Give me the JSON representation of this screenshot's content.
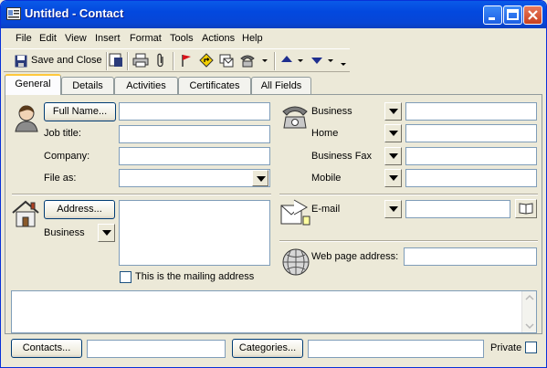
{
  "window": {
    "title": "Untitled - Contact"
  },
  "menu": [
    "File",
    "Edit",
    "View",
    "Insert",
    "Format",
    "Tools",
    "Actions",
    "Help"
  ],
  "toolbar": {
    "save_close": "Save and Close"
  },
  "tabs": [
    "General",
    "Details",
    "Activities",
    "Certificates",
    "All Fields"
  ],
  "general": {
    "full_name_btn": "Full Name...",
    "job_title": "Job title:",
    "company": "Company:",
    "file_as": "File as:",
    "address_btn": "Address...",
    "address_type": "Business",
    "mailing_checkbox": "This is the mailing address",
    "phones": [
      "Business",
      "Home",
      "Business Fax",
      "Mobile"
    ],
    "email_label": "E-mail",
    "web_label": "Web page address:"
  },
  "bottom": {
    "contacts_btn": "Contacts...",
    "categories_btn": "Categories...",
    "private_label": "Private"
  }
}
